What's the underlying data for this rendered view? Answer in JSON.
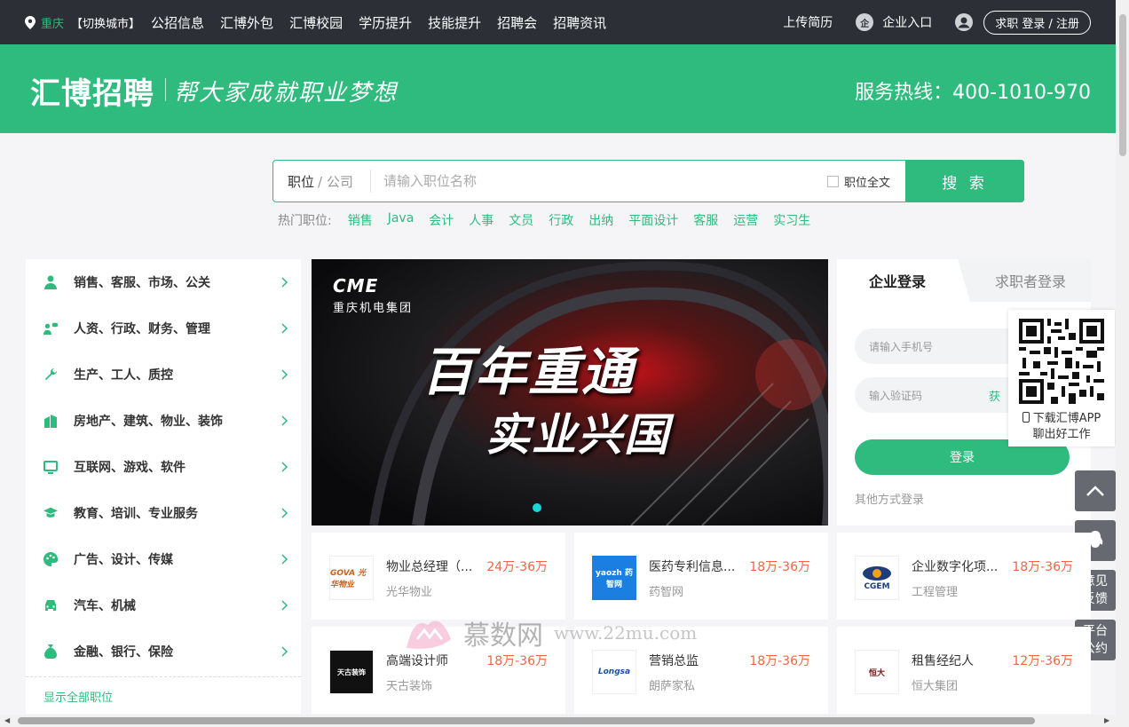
{
  "topnav": {
    "city": "重庆",
    "switch_city": "【切换城市】",
    "links": [
      "公招信息",
      "汇博外包",
      "汇博校园",
      "学历提升",
      "技能提升",
      "招聘会",
      "招聘资讯"
    ],
    "upload_resume": "上传简历",
    "enterprise_icon": "企",
    "enterprise_entry": "企业入口",
    "login_register": "求职 登录 / 注册"
  },
  "header": {
    "logo": "汇博招聘",
    "slogan": "帮大家成就职业梦想",
    "hotline": "服务热线：400-1010-970"
  },
  "search": {
    "type_primary": "职位",
    "type_secondary": "/ 公司",
    "placeholder": "请输入职位名称",
    "fulltext_label": "职位全文",
    "button": "搜 索",
    "hot_label": "热门职位:",
    "hot_keywords": [
      "销售",
      "Java",
      "会计",
      "人事",
      "文员",
      "行政",
      "出纳",
      "平面设计",
      "客服",
      "运营",
      "实习生"
    ]
  },
  "categories": {
    "items": [
      {
        "label": "销售、客服、市场、公关",
        "icon": "person-icon"
      },
      {
        "label": "人资、行政、财务、管理",
        "icon": "people-icon"
      },
      {
        "label": "生产、工人、质控",
        "icon": "wrench-icon"
      },
      {
        "label": "房地产、建筑、物业、装饰",
        "icon": "building-icon"
      },
      {
        "label": "互联网、游戏、软件",
        "icon": "monitor-icon"
      },
      {
        "label": "教育、培训、专业服务",
        "icon": "graduation-cap-icon"
      },
      {
        "label": "广告、设计、传媒",
        "icon": "palette-icon"
      },
      {
        "label": "汽车、机械",
        "icon": "car-icon"
      },
      {
        "label": "金融、银行、保险",
        "icon": "money-bag-icon"
      }
    ],
    "show_all": "显示全部职位"
  },
  "banner": {
    "company_logo": "CME",
    "company_name": "重庆机电集团",
    "line1": "百年重通",
    "line2": "实业兴国"
  },
  "login": {
    "tab_enterprise": "企业登录",
    "tab_seeker": "求职者登录",
    "phone_placeholder": "请输入手机号",
    "code_placeholder": "输入验证码",
    "get_code": "获",
    "submit": "登录",
    "other_methods": "其他方式登录"
  },
  "qr_float": {
    "line1": "下载汇博APP",
    "line2": "聊出好工作"
  },
  "float_buttons": {
    "feedback_1": "意见",
    "feedback_2": "反馈",
    "convention_1": "平台",
    "convention_2": "公约"
  },
  "jobs": [
    {
      "title": "物业总经理（...",
      "salary": "24万-36万",
      "company": "光华物业",
      "logo_text": "GOVA 光华物业"
    },
    {
      "title": "医药专利信息...",
      "salary": "18万-36万",
      "company": "药智网",
      "logo_text": "yaozh 药智网"
    },
    {
      "title": "企业数字化项...",
      "salary": "18万-36万",
      "company": "工程管理",
      "logo_text": "CGEM"
    },
    {
      "title": "高端设计师",
      "salary": "18万-36万",
      "company": "天古装饰",
      "logo_text": "天古装饰"
    },
    {
      "title": "营销总监",
      "salary": "18万-36万",
      "company": "朗萨家私",
      "logo_text": "Longsa"
    },
    {
      "title": "租售经纪人",
      "salary": "12万-36万",
      "company": "恒大集团",
      "logo_text": "恒大"
    }
  ],
  "watermark": {
    "brand": "慕数网",
    "url": "www.22mu.com"
  },
  "colors": {
    "brand_green": "#2fbb7e",
    "nav_dark": "#2c3036",
    "salary_orange": "#f26644"
  }
}
